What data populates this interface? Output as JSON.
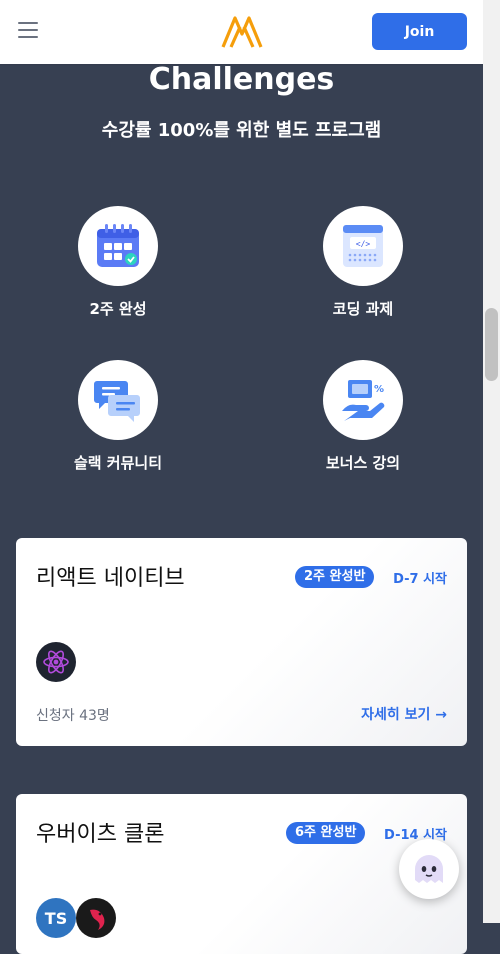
{
  "header": {
    "menu_icon": "hamburger-menu-icon",
    "logo_icon": "m-logo-icon",
    "join_label": "Join"
  },
  "challenges": {
    "title": "Challenges",
    "subtitle": "수강률 100%를 위한 별도 프로그램",
    "features": [
      {
        "label": "2주 완성",
        "icon": "calendar-icon"
      },
      {
        "label": "코딩 과제",
        "icon": "code-editor-icon"
      },
      {
        "label": "슬랙 커뮤니티",
        "icon": "chat-bubbles-icon"
      },
      {
        "label": "보너스 강의",
        "icon": "bonus-lecture-icon"
      }
    ]
  },
  "courses": [
    {
      "title": "리액트 네이티브",
      "badge": "2주 완성반",
      "dday": "D-7 시작",
      "tech": [
        "react-icon"
      ],
      "applicants": "신청자 43명",
      "link": "자세히 보기 →"
    },
    {
      "title": "우버이츠 클론",
      "badge": "6주 완성반",
      "dday": "D-14 시작",
      "tech": [
        "typescript-icon",
        "nestjs-icon"
      ],
      "tech_text": [
        "TS"
      ]
    }
  ],
  "chat": {
    "icon": "chat-ghost-icon"
  },
  "colors": {
    "accent": "#2f6ee8",
    "background": "#374052",
    "logo": "#f59e0b"
  }
}
